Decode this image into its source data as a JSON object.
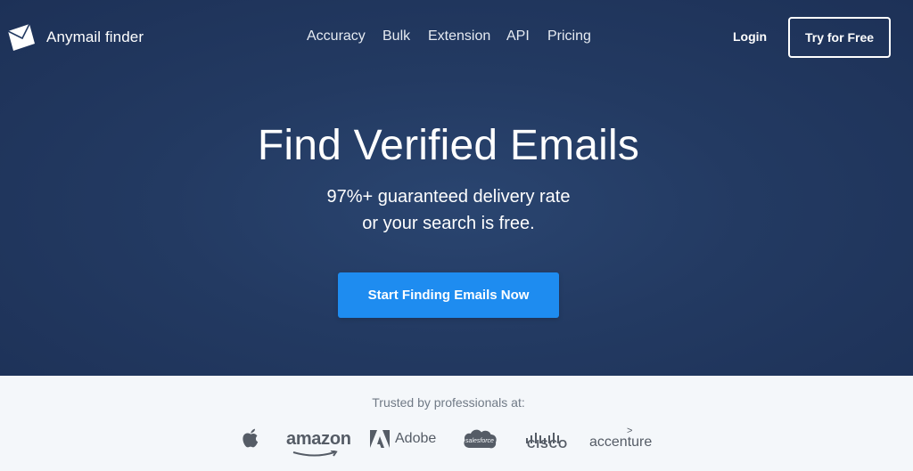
{
  "brand": {
    "name": "Anymail finder",
    "logo_icon": "envelope-icon"
  },
  "nav": {
    "items": [
      "Accuracy",
      "Bulk",
      "Extension",
      "API",
      "Pricing"
    ],
    "login_label": "Login",
    "cta_label": "Try for Free"
  },
  "hero": {
    "title": "Find Verified Emails",
    "subtitle_line1": "97%+ guaranteed delivery rate",
    "subtitle_line2": "or your search is free.",
    "button_label": "Start Finding Emails Now"
  },
  "trusted": {
    "label": "Trusted by professionals at:",
    "logos": {
      "apple": "apple-logo-icon",
      "amazon": "amazon",
      "adobe": "Adobe",
      "salesforce": "salesforce",
      "cisco": "CISCO",
      "accenture": "accenture"
    }
  },
  "colors": {
    "hero_bg": "#233a62",
    "cta_blue": "#1e8cf0",
    "footer_bg": "#f4f7fa",
    "logo_gray": "#555c66"
  }
}
